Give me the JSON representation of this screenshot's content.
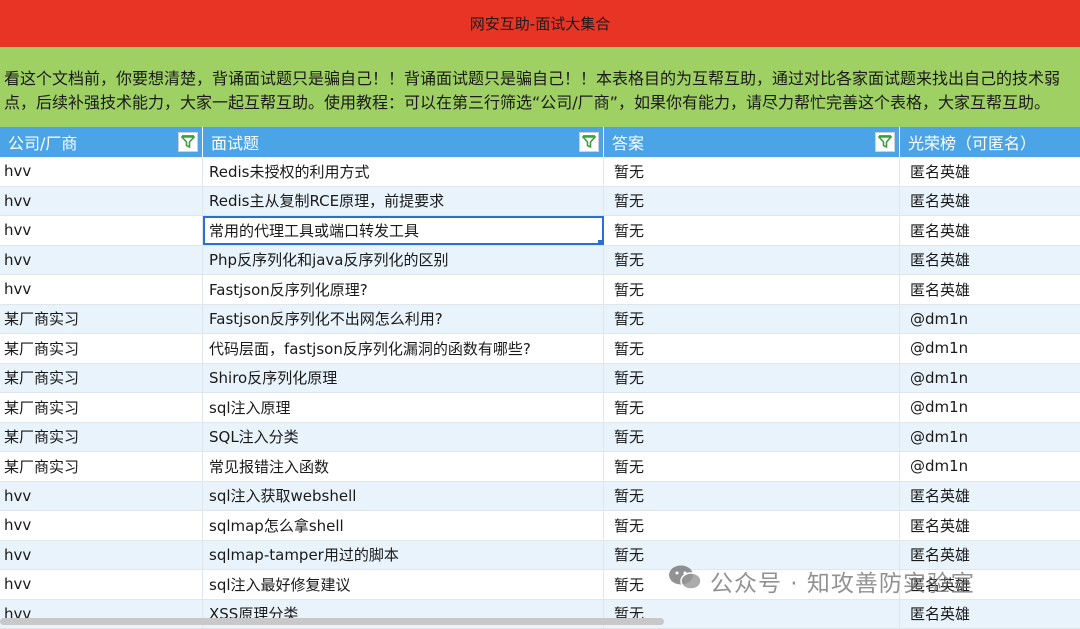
{
  "title": "网安互助-面试大集合",
  "notice": {
    "line1": "看这个文档前，你要想清楚，背诵面试题只是骗自己！！背诵面试题只是骗自己！！本表格目的为互帮互助，通过对比各家面试题来找出自己的技术弱",
    "line2": "点，后续补强技术能力，大家一起互帮互助。使用教程：可以在第三行筛选“公司/厂商”，如果你有能力，请尽力帮忙完善这个表格，大家互帮互助。"
  },
  "columns": [
    "公司/厂商",
    "面试题",
    "答案",
    "光荣榜（可匿名）"
  ],
  "rows": [
    [
      "hvv",
      "Redis未授权的利用方式",
      "暂无",
      "匿名英雄"
    ],
    [
      "hvv",
      "Redis主从复制RCE原理，前提要求",
      "暂无",
      "匿名英雄"
    ],
    [
      "hvv",
      "常用的代理工具或端口转发工具",
      "暂无",
      "匿名英雄"
    ],
    [
      "hvv",
      "Php反序列化和java反序列化的区别",
      "暂无",
      "匿名英雄"
    ],
    [
      "hvv",
      "Fastjson反序列化原理?",
      "暂无",
      "匿名英雄"
    ],
    [
      "某厂商实习",
      "Fastjson反序列化不出网怎么利用?",
      "暂无",
      "@dm1n"
    ],
    [
      "某厂商实习",
      "代码层面，fastjson反序列化漏洞的函数有哪些?",
      "暂无",
      "@dm1n"
    ],
    [
      "某厂商实习",
      "Shiro反序列化原理",
      "暂无",
      "@dm1n"
    ],
    [
      "某厂商实习",
      "sql注入原理",
      "暂无",
      "@dm1n"
    ],
    [
      "某厂商实习",
      "SQL注入分类",
      "暂无",
      "@dm1n"
    ],
    [
      "某厂商实习",
      "常见报错注入函数",
      "暂无",
      "@dm1n"
    ],
    [
      "hvv",
      "sql注入获取webshell",
      "暂无",
      "匿名英雄"
    ],
    [
      "hvv",
      "sqlmap怎么拿shell",
      "暂无",
      "匿名英雄"
    ],
    [
      "hvv",
      "sqlmap-tamper用过的脚本",
      "暂无",
      "匿名英雄"
    ],
    [
      "hvv",
      "sql注入最好修复建议",
      "暂无",
      "匿名英雄"
    ],
    [
      "hvv",
      "XSS原理分类",
      "暂无",
      "匿名英雄"
    ]
  ],
  "watermark": "公众号 · 知攻善防实验室",
  "colors": {
    "title_bg": "#e83424",
    "notice_bg": "#9fd063",
    "header_bg": "#4aa4e6",
    "alt_row": "#e8f3fb",
    "selection": "#2a6fd6"
  }
}
